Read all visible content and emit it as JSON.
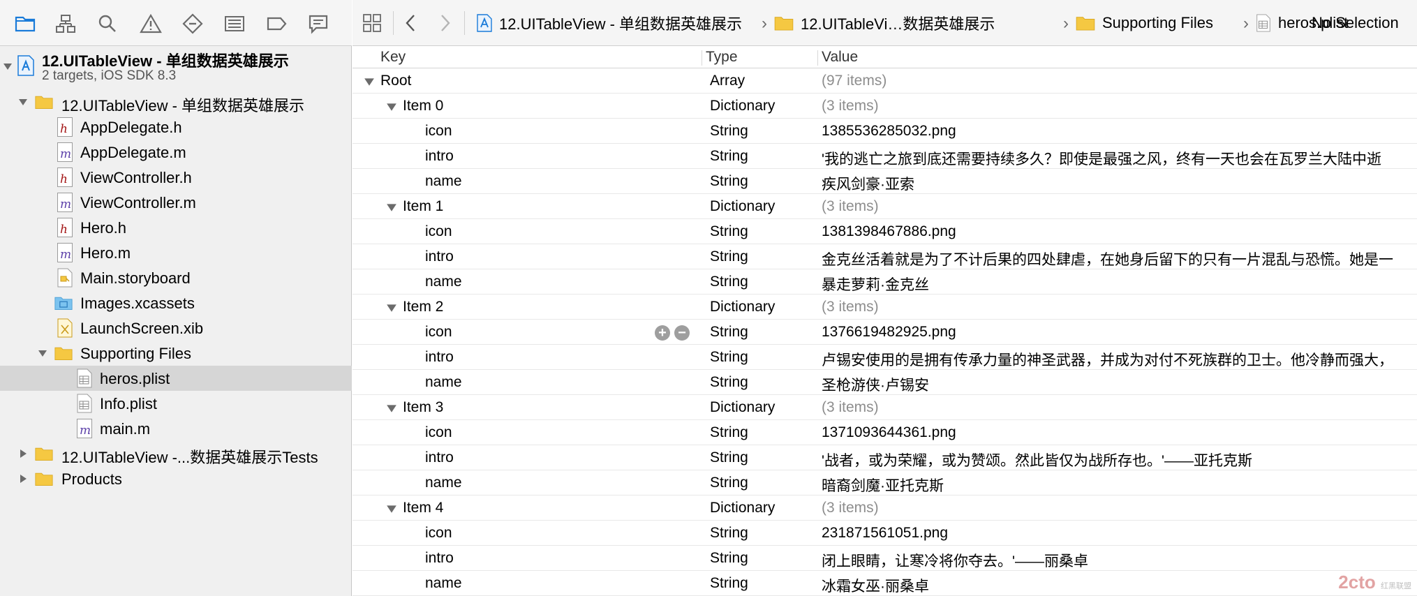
{
  "navigator": {
    "toolbar_icons": [
      "folder-icon",
      "hierarchy-icon",
      "search-icon",
      "warning-icon",
      "test-icon",
      "list-icon",
      "label-icon",
      "chat-icon"
    ],
    "project": {
      "name": "12.UITableView - 单组数据英雄展示",
      "subtitle": "2 targets, iOS SDK 8.3"
    },
    "items": [
      {
        "label": "12.UITableView - 单组数据英雄展示",
        "kind": "folder"
      },
      {
        "label": "AppDelegate.h",
        "kind": "h"
      },
      {
        "label": "AppDelegate.m",
        "kind": "m"
      },
      {
        "label": "ViewController.h",
        "kind": "h"
      },
      {
        "label": "ViewController.m",
        "kind": "m"
      },
      {
        "label": "Hero.h",
        "kind": "h"
      },
      {
        "label": "Hero.m",
        "kind": "m"
      },
      {
        "label": "Main.storyboard",
        "kind": "storyboard"
      },
      {
        "label": "Images.xcassets",
        "kind": "xcassets"
      },
      {
        "label": "LaunchScreen.xib",
        "kind": "xib"
      },
      {
        "label": "Supporting Files",
        "kind": "folder"
      },
      {
        "label": "heros.plist",
        "kind": "plist"
      },
      {
        "label": "Info.plist",
        "kind": "plist"
      },
      {
        "label": "main.m",
        "kind": "m"
      },
      {
        "label": "12.UITableView -...数据英雄展示Tests",
        "kind": "folder"
      },
      {
        "label": "Products",
        "kind": "folder"
      }
    ]
  },
  "jumpbar": {
    "segments": [
      "12.UITableView - 单组数据英雄展示",
      "12.UITableVi…数据英雄展示",
      "Supporting Files",
      "heros.plist",
      "No Selection"
    ]
  },
  "plist": {
    "headers": {
      "key": "Key",
      "type": "Type",
      "value": "Value"
    },
    "rows": [
      {
        "key": "Root",
        "type": "Array",
        "value": "(97 items)"
      },
      {
        "key": "Item 0",
        "type": "Dictionary",
        "value": "(3 items)"
      },
      {
        "key": "icon",
        "type": "String",
        "value": "1385536285032.png"
      },
      {
        "key": "intro",
        "type": "String",
        "value": "'我的逃亡之旅到底还需要持续多久？即使是最强之风，终有一天也会在瓦罗兰大陆中逝"
      },
      {
        "key": "name",
        "type": "String",
        "value": "疾风剑豪·亚索"
      },
      {
        "key": "Item 1",
        "type": "Dictionary",
        "value": "(3 items)"
      },
      {
        "key": "icon",
        "type": "String",
        "value": "1381398467886.png"
      },
      {
        "key": "intro",
        "type": "String",
        "value": "金克丝活着就是为了不计后果的四处肆虐，在她身后留下的只有一片混乱与恐慌。她是一"
      },
      {
        "key": "name",
        "type": "String",
        "value": "暴走萝莉·金克丝"
      },
      {
        "key": "Item 2",
        "type": "Dictionary",
        "value": "(3 items)"
      },
      {
        "key": "icon",
        "type": "String",
        "value": "1376619482925.png"
      },
      {
        "key": "intro",
        "type": "String",
        "value": "卢锡安使用的是拥有传承力量的神圣武器，并成为对付不死族群的卫士。他冷静而强大，"
      },
      {
        "key": "name",
        "type": "String",
        "value": "圣枪游侠·卢锡安"
      },
      {
        "key": "Item 3",
        "type": "Dictionary",
        "value": "(3 items)"
      },
      {
        "key": "icon",
        "type": "String",
        "value": "1371093644361.png"
      },
      {
        "key": "intro",
        "type": "String",
        "value": "'战者，或为荣耀，或为赞颂。然此皆仅为战所存也。'——亚托克斯"
      },
      {
        "key": "name",
        "type": "String",
        "value": "暗裔剑魔·亚托克斯"
      },
      {
        "key": "Item 4",
        "type": "Dictionary",
        "value": "(3 items)"
      },
      {
        "key": "icon",
        "type": "String",
        "value": "231871561051.png"
      },
      {
        "key": "intro",
        "type": "String",
        "value": "闭上眼睛，让寒冷将你夺去。'——丽桑卓"
      },
      {
        "key": "name",
        "type": "String",
        "value": "冰霜女巫·丽桑卓"
      }
    ]
  },
  "watermark": {
    "main": "2cto",
    "sub": "红黑联盟"
  },
  "colors": {
    "accent": "#1a7bd9",
    "folder": "#f5c842",
    "selected_row": "#d6d6d6"
  }
}
